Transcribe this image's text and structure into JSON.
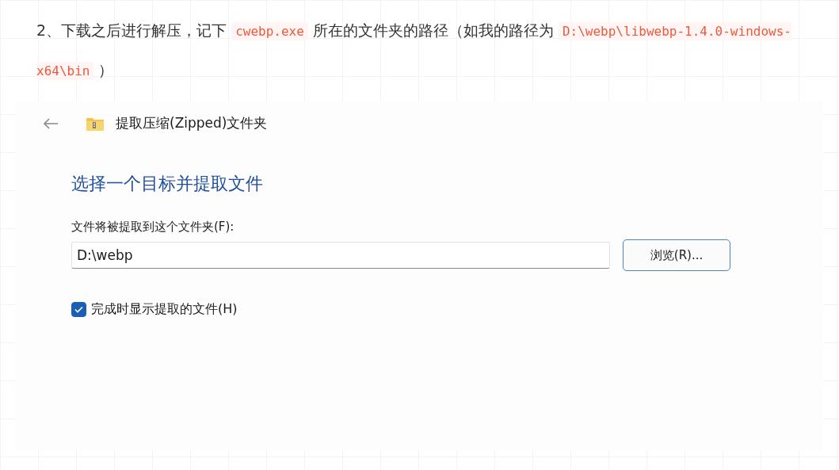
{
  "paragraph": [
    {
      "kind": "text",
      "text": "2、下载之后进行解压，记下 "
    },
    {
      "kind": "code",
      "text": "cwebp.exe"
    },
    {
      "kind": "text",
      "text": " 所在的文件夹的路径（如我的路径为 "
    },
    {
      "kind": "code",
      "text": "D:\\webp\\libwebp-1.4.0-windows-x64\\bin"
    },
    {
      "kind": "text",
      "text": " ）"
    }
  ],
  "dialog": {
    "title": "提取压缩(Zipped)文件夹",
    "heading": "选择一个目标并提取文件",
    "field_label": "文件将被提取到这个文件夹(F):",
    "path_value": "D:\\webp",
    "browse_button": "浏览(R)...",
    "show_files": {
      "label": "完成时显示提取的文件(H)",
      "checked": true
    }
  }
}
